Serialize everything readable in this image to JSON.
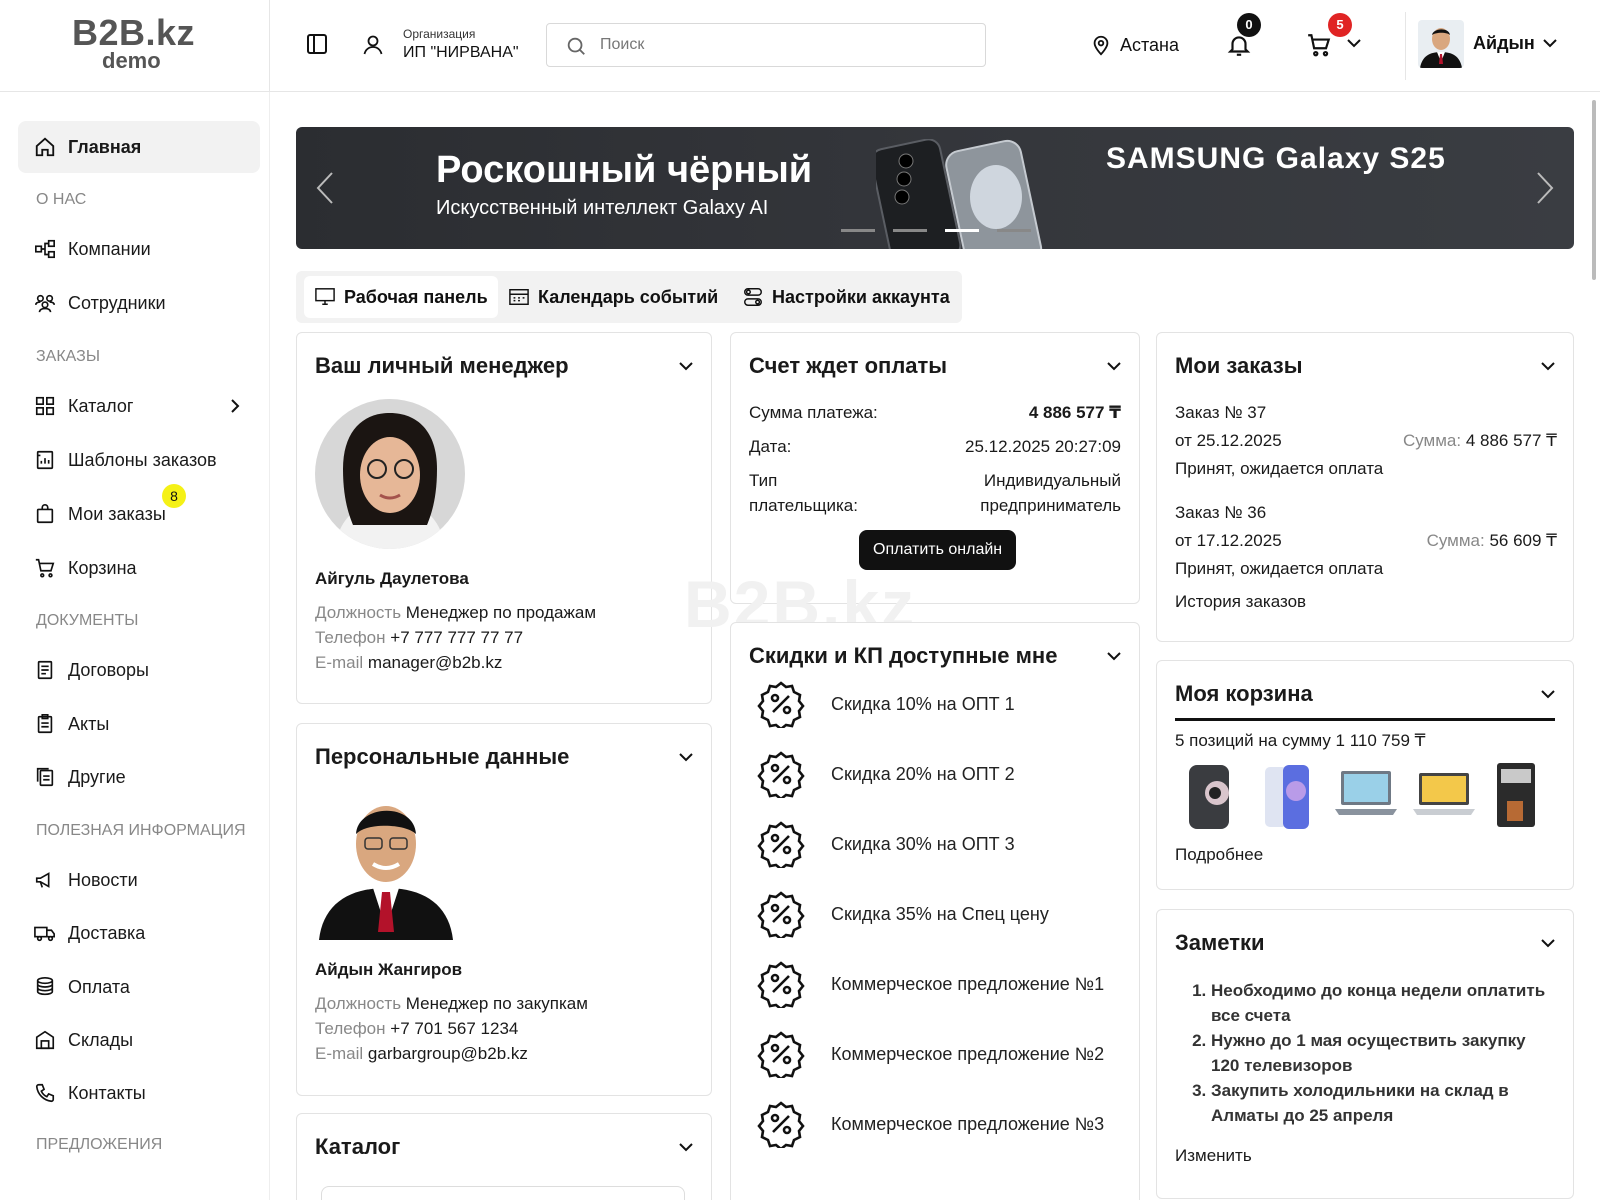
{
  "header": {
    "logo_main": "B2B.kz",
    "logo_sub": "demo",
    "org_label": "Организация",
    "org_name": "ИП \"НИРВАНА\"",
    "search_placeholder": "Поиск",
    "city": "Астана",
    "notifications_count": "0",
    "cart_count": "5",
    "user_name": "Айдын"
  },
  "sidebar": {
    "home": "Главная",
    "section_about": "О НАС",
    "companies": "Компании",
    "employees": "Сотрудники",
    "section_orders": "ЗАКАЗЫ",
    "catalog": "Каталог",
    "order_templates": "Шаблоны заказов",
    "my_orders": "Мои заказы",
    "my_orders_badge": "8",
    "cart": "Корзина",
    "section_docs": "ДОКУМЕНТЫ",
    "contracts": "Договоры",
    "acts": "Акты",
    "other": "Другие",
    "section_info": "ПОЛЕЗНАЯ ИНФОРМАЦИЯ",
    "news": "Новости",
    "delivery": "Доставка",
    "payment": "Оплата",
    "warehouses": "Склады",
    "contacts": "Контакты",
    "section_offers": "ПРЕДЛОЖЕНИЯ"
  },
  "banner": {
    "title": "Роскошный чёрный",
    "subtitle": "Искусственный интеллект Galaxy AI",
    "brand": "SAMSUNG Galaxy S25",
    "active_slide_index": 2,
    "slide_count": 4
  },
  "tabs": [
    {
      "label": "Рабочая панель"
    },
    {
      "label": "Календарь событий"
    },
    {
      "label": "Настройки аккаунта"
    }
  ],
  "manager_card": {
    "title": "Ваш личный менеджер",
    "name": "Айгуль Даулетова",
    "position_label": "Должность",
    "position": "Менеджер по продажам",
    "phone_label": "Телефон",
    "phone": "+7 777 777 77 77",
    "email_label": "E-mail",
    "email": "manager@b2b.kz"
  },
  "personal_card": {
    "title": "Персональные данные",
    "name": "Айдын Жангиров",
    "position_label": "Должность",
    "position": "Менеджер по закупкам",
    "phone_label": "Телефон",
    "phone": "+7 701 567 1234",
    "email_label": "E-mail",
    "email": "garbargroup@b2b.kz"
  },
  "catalog_card": {
    "title": "Каталог"
  },
  "invoice_card": {
    "title": "Счет ждет оплаты",
    "amount_label": "Сумма платежа:",
    "amount": "4 886 577 ₸",
    "date_label": "Дата:",
    "date": "25.12.2025 20:27:09",
    "payer_label_1": "Тип",
    "payer_label_2": "плательщика:",
    "payer_value_1": "Индивидуальный",
    "payer_value_2": "предприниматель",
    "pay_button": "Оплатить онлайн"
  },
  "watermark": "B2B.kz",
  "discounts_card": {
    "title": "Скидки и КП доступные мне",
    "items": [
      "Скидка 10% на ОПТ 1",
      "Скидка 20% на ОПТ 2",
      "Скидка 30% на ОПТ 3",
      "Скидка 35% на Спец цену",
      "Коммерческое предложение №1",
      "Коммерческое предложение №2",
      "Коммерческое предложение №3"
    ]
  },
  "orders_card": {
    "title": "Мои заказы",
    "orders": [
      {
        "number": "Заказ № 37",
        "date": "от 25.12.2025",
        "sum_label": "Сумма:",
        "sum": "4 886 577 ₸",
        "status": "Принят, ожидается оплата"
      },
      {
        "number": "Заказ № 36",
        "date": "от 17.12.2025",
        "sum_label": "Сумма:",
        "sum": "56 609 ₸",
        "status": "Принят, ожидается оплата"
      }
    ],
    "history_link": "История заказов"
  },
  "basket_card": {
    "title": "Моя корзина",
    "summary": "5 позиций на сумму 1 110 759 ₸",
    "more_link": "Подробнее",
    "product_icons": [
      "phone-pink-icon",
      "phone-blue-icon",
      "laptop-gray-icon",
      "laptop-silver-icon",
      "coffee-machine-icon"
    ]
  },
  "notes_card": {
    "title": "Заметки",
    "items": [
      "Необходимо до конца недели оплатить все счета",
      "Нужно до 1 мая осуществить закупку 120 телевизоров",
      "Закупить холодильники на склад в Алматы до 25 апреля"
    ],
    "edit_link": "Изменить"
  }
}
